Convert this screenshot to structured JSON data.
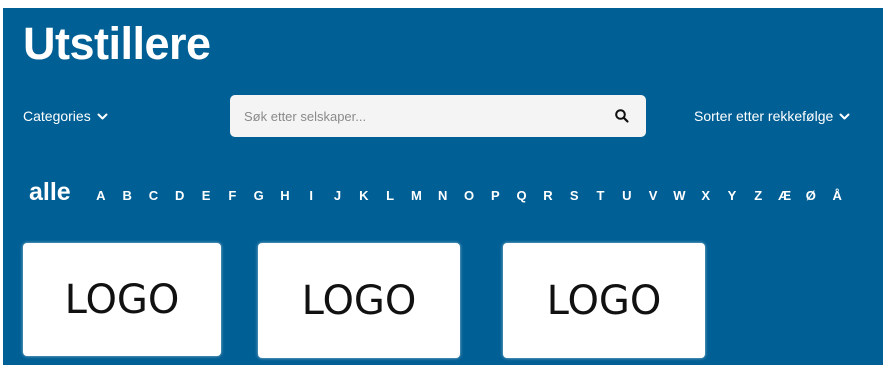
{
  "header": {
    "title": "Utstillere"
  },
  "filters": {
    "categories_label": "Categories",
    "search_placeholder": "Søk etter selskaper...",
    "sort_label": "Sorter etter rekkefølge"
  },
  "alphabet": {
    "all_label": "alle",
    "letters": [
      "A",
      "B",
      "C",
      "D",
      "E",
      "F",
      "G",
      "H",
      "I",
      "J",
      "K",
      "L",
      "M",
      "N",
      "O",
      "P",
      "Q",
      "R",
      "S",
      "T",
      "U",
      "V",
      "W",
      "X",
      "Y",
      "Z",
      "Æ",
      "Ø",
      "Å"
    ]
  },
  "exhibitors": [
    {
      "logo_text": "LOGO"
    },
    {
      "logo_text": "LOGO"
    },
    {
      "logo_text": "LOGO"
    }
  ],
  "colors": {
    "background": "#005f95",
    "card": "#ffffff"
  },
  "icons": {
    "search": "search-icon",
    "dropdown": "chevron-down-icon"
  }
}
